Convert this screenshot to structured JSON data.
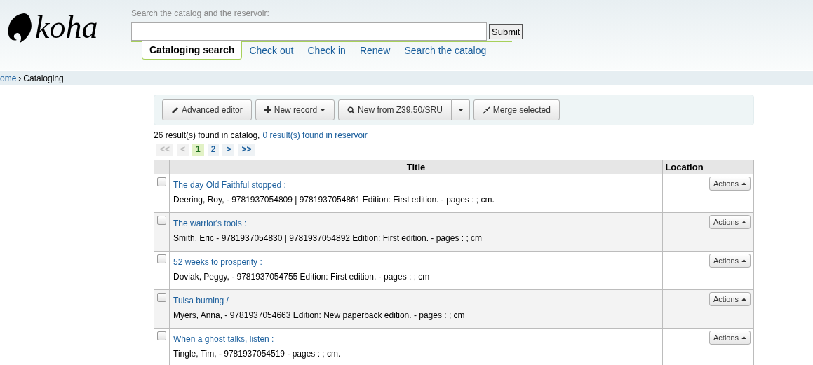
{
  "logo": {
    "text": "koha"
  },
  "search": {
    "label": "Search the catalog and the reservoir:",
    "button": "Submit"
  },
  "tabs": [
    {
      "label": "Cataloging search",
      "selected": true
    },
    {
      "label": "Check out",
      "selected": false
    },
    {
      "label": "Check in",
      "selected": false
    },
    {
      "label": "Renew",
      "selected": false
    },
    {
      "label": "Search the catalog",
      "selected": false
    }
  ],
  "breadcrumb": [
    {
      "label": "ome",
      "kind": "link"
    },
    {
      "label": "›",
      "kind": "separator"
    },
    {
      "label": "Cataloging",
      "kind": "current"
    }
  ],
  "toolbar": [
    {
      "label": "Advanced editor",
      "kind": "pencil"
    },
    {
      "label": "New record",
      "kind": "plus-caret"
    },
    {
      "label": "New from Z39.50/SRU",
      "kind": "search-split"
    },
    {
      "label": "Merge selected",
      "kind": "merge"
    }
  ],
  "results": {
    "catalog": "26 result(s) found in catalog,",
    "reservoir": "0 result(s) found in reservoir"
  },
  "pager": [
    {
      "label": "<<",
      "disabled": true,
      "selected": false
    },
    {
      "label": "<",
      "disabled": true,
      "selected": false
    },
    {
      "label": "1",
      "disabled": false,
      "selected": true
    },
    {
      "label": "2",
      "disabled": false,
      "selected": false
    },
    {
      "label": ">",
      "disabled": false,
      "selected": false
    },
    {
      "label": ">>",
      "disabled": false,
      "selected": false
    }
  ],
  "table": {
    "columns": [
      "Title",
      "Location"
    ],
    "rows": [
      {
        "checked": false,
        "title": "The day Old Faithful stopped :",
        "details": "Deering, Roy, - 9781937054809 | 9781937054861 Edition: First edition. - pages : ; cm.",
        "action": "Actions"
      },
      {
        "checked": false,
        "title": "The warrior's tools :",
        "details": "Smith, Eric - 9781937054830 | 9781937054892 Edition: First edition. - pages : ; cm",
        "action": "Actions"
      },
      {
        "checked": false,
        "title": "52 weeks to prosperity :",
        "details": "Doviak, Peggy, - 9781937054755 Edition: First edition. - pages : ; cm",
        "action": "Actions"
      },
      {
        "checked": false,
        "title": "Tulsa burning /",
        "details": "Myers, Anna, - 9781937054663 Edition: New paperback edition. - pages : ; cm",
        "action": "Actions"
      },
      {
        "checked": false,
        "title": "When a ghost talks, listen :",
        "details": "Tingle, Tim, - 9781937054519 - pages : ; cm.",
        "action": "Actions"
      }
    ]
  }
}
